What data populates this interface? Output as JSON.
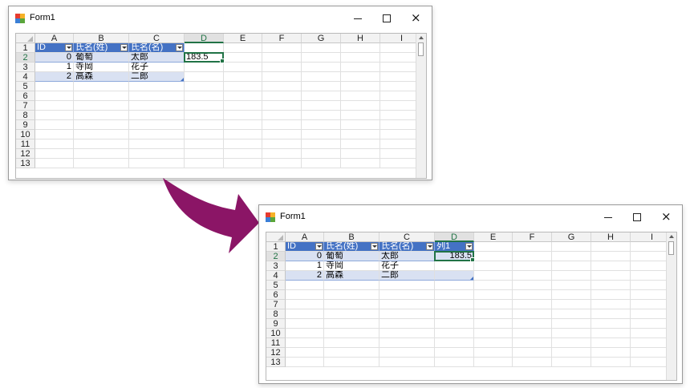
{
  "window_title": "Form1",
  "window_controls": {
    "minimize": "minimize",
    "maximize": "maximize",
    "close": "×"
  },
  "column_letters": [
    "A",
    "B",
    "C",
    "D",
    "E",
    "F",
    "G",
    "H",
    "I"
  ],
  "row_numbers": [
    "1",
    "2",
    "3",
    "4",
    "5",
    "6",
    "7",
    "8",
    "9",
    "10",
    "11",
    "12",
    "13"
  ],
  "before": {
    "headers": [
      "ID",
      "氏名(姓)",
      "氏名(名)"
    ],
    "rows": [
      {
        "id": "0",
        "sei": "葡萄",
        "mei": "太郎"
      },
      {
        "id": "1",
        "sei": "寺岡",
        "mei": "花子"
      },
      {
        "id": "2",
        "sei": "高森",
        "mei": "二郎"
      }
    ],
    "input_cell_value": "183.5"
  },
  "after": {
    "headers": [
      "ID",
      "氏名(姓)",
      "氏名(名)",
      "列1"
    ],
    "rows": [
      {
        "id": "0",
        "sei": "葡萄",
        "mei": "太郎",
        "col1": "183.5"
      },
      {
        "id": "1",
        "sei": "寺岡",
        "mei": "花子",
        "col1": ""
      },
      {
        "id": "2",
        "sei": "高森",
        "mei": "二郎",
        "col1": ""
      }
    ]
  },
  "colors": {
    "table_header": "#4472c4",
    "table_band": "#d9e1f2",
    "selection": "#217346",
    "arrow": "#8b1566"
  },
  "icons": {
    "app": "form-app-icon",
    "transition": "curved-arrow-icon",
    "filter": "filter-dropdown-icon"
  }
}
